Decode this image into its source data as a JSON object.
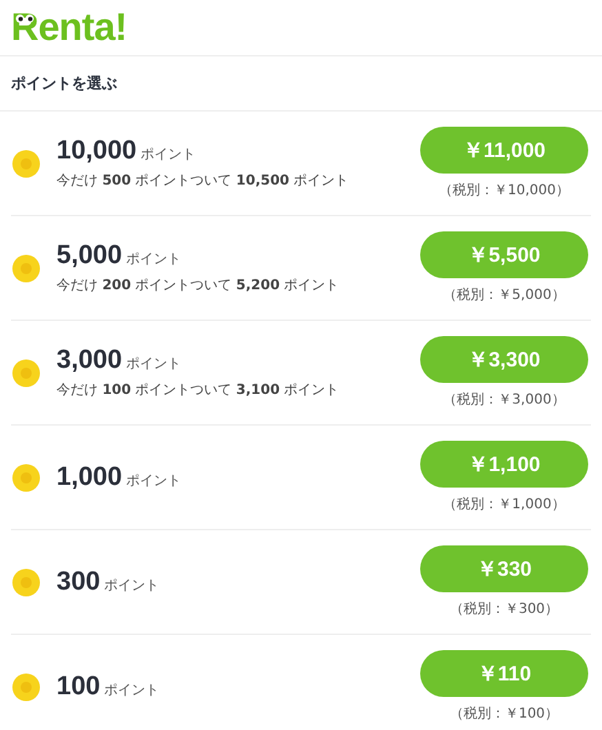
{
  "logo": "Renta!",
  "section_title": "ポイントを選ぶ",
  "packages": [
    {
      "points": "10,000",
      "unit": "ポイント",
      "bonus": "今だけ **500** ポイントついて **10,500** ポイント",
      "price": "￥11,000",
      "tax_note": "（税別：￥10,000）"
    },
    {
      "points": "5,000",
      "unit": "ポイント",
      "bonus": "今だけ **200** ポイントついて **5,200** ポイント",
      "price": "￥5,500",
      "tax_note": "（税別：￥5,000）"
    },
    {
      "points": "3,000",
      "unit": "ポイント",
      "bonus": "今だけ **100** ポイントついて **3,100** ポイント",
      "price": "￥3,300",
      "tax_note": "（税別：￥3,000）"
    },
    {
      "points": "1,000",
      "unit": "ポイント",
      "price": "￥1,100",
      "tax_note": "（税別：￥1,000）"
    },
    {
      "points": "300",
      "unit": "ポイント",
      "price": "￥330",
      "tax_note": "（税別：￥300）"
    },
    {
      "points": "100",
      "unit": "ポイント",
      "price": "￥110",
      "tax_note": "（税別：￥100）"
    }
  ]
}
